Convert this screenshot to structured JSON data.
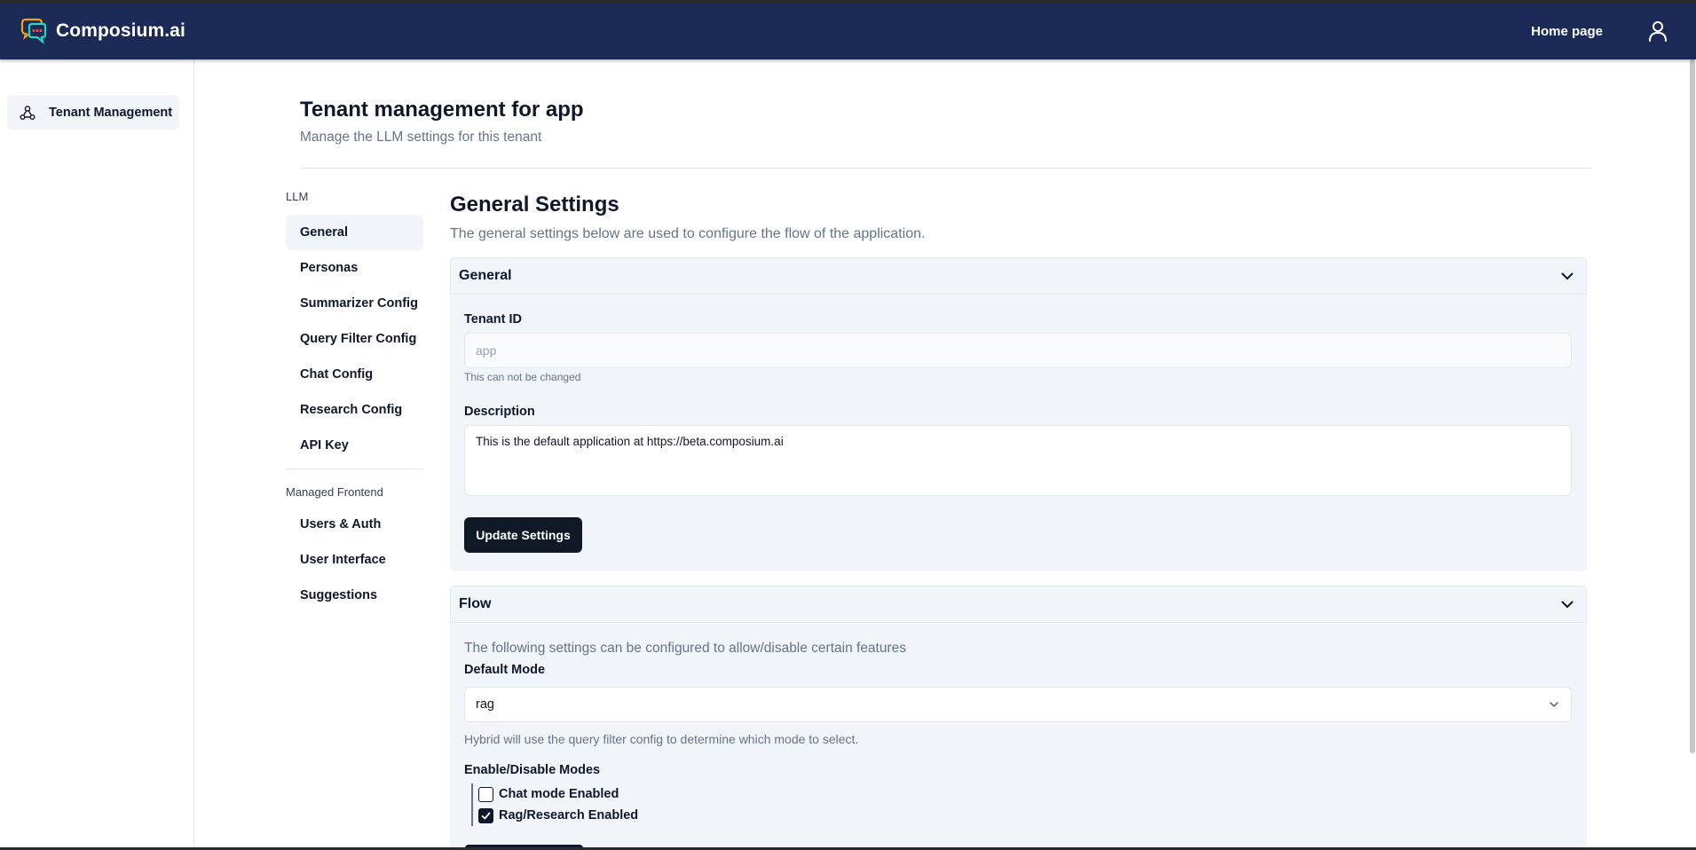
{
  "navbar": {
    "brand": "Composium.ai",
    "home_link": "Home page",
    "logo_icon": "chat-bubbles-logo-icon",
    "user_icon": "user-icon"
  },
  "sidebar": {
    "items": [
      {
        "label": "Tenant Management",
        "icon": "users-network-icon",
        "active": true
      }
    ]
  },
  "header": {
    "title": "Tenant management for app",
    "subtitle": "Manage the LLM settings for this tenant"
  },
  "subnav": {
    "groups": [
      {
        "label": "LLM",
        "items": [
          "General",
          "Personas",
          "Summarizer Config",
          "Query Filter Config",
          "Chat Config",
          "Research Config",
          "API Key"
        ]
      },
      {
        "label": "Managed Frontend",
        "items": [
          "Users & Auth",
          "User Interface",
          "Suggestions"
        ]
      }
    ],
    "active": "General"
  },
  "main": {
    "title": "General Settings",
    "subtitle": "The general settings below are used to configure the flow of the application."
  },
  "general_panel": {
    "title": "General",
    "tenant_id_label": "Tenant ID",
    "tenant_id_value": "app",
    "tenant_id_hint": "This can not be changed",
    "description_label": "Description",
    "description_value": "This is the default application at https://beta.composium.ai",
    "update_button": "Update Settings"
  },
  "flow_panel": {
    "title": "Flow",
    "intro": "The following settings can be configured to allow/disable certain features",
    "default_mode_label": "Default Mode",
    "default_mode_value": "rag",
    "default_mode_hint": "Hybrid will use the query filter config to determine which mode to select.",
    "modes_label": "Enable/Disable Modes",
    "modes": [
      {
        "label": "Chat mode Enabled",
        "checked": false
      },
      {
        "label": "Rag/Research Enabled",
        "checked": true
      }
    ]
  },
  "colors": {
    "navbar": "#1b2a56",
    "button": "#111827",
    "panel": "#f1f5f9",
    "muted_text": "#64748b"
  }
}
